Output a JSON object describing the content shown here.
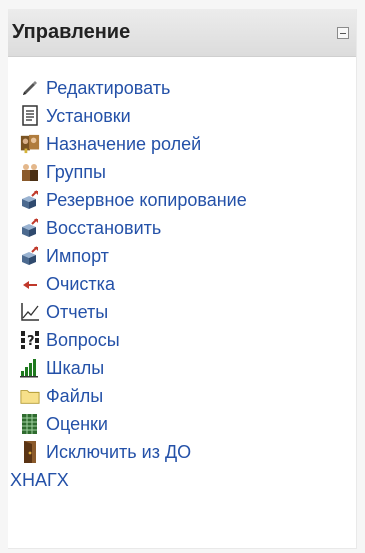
{
  "block": {
    "title": "Управление",
    "items": [
      {
        "label": "Редактировать",
        "icon": "edit-pencil-icon"
      },
      {
        "label": "Установки",
        "icon": "settings-document-icon"
      },
      {
        "label": "Назначение ролей",
        "icon": "assign-roles-icon"
      },
      {
        "label": "Группы",
        "icon": "groups-icon"
      },
      {
        "label": "Резервное копирование",
        "icon": "backup-icon"
      },
      {
        "label": "Восстановить",
        "icon": "restore-icon"
      },
      {
        "label": "Импорт",
        "icon": "import-icon"
      },
      {
        "label": "Очистка",
        "icon": "reset-arrow-icon"
      },
      {
        "label": "Отчеты",
        "icon": "reports-chart-icon"
      },
      {
        "label": "Вопросы",
        "icon": "questions-icon"
      },
      {
        "label": "Шкалы",
        "icon": "scales-bars-icon"
      },
      {
        "label": "Файлы",
        "icon": "folder-icon"
      },
      {
        "label": "Оценки",
        "icon": "grades-table-icon"
      },
      {
        "label": "Исключить из ДО",
        "icon": "unenrol-door-icon"
      },
      {
        "label": "ХНАГХ"
      }
    ]
  },
  "colors": {
    "link": "#2451a8",
    "header_bg": "#e3e3e3",
    "page_bg": "#f6f6f6"
  }
}
